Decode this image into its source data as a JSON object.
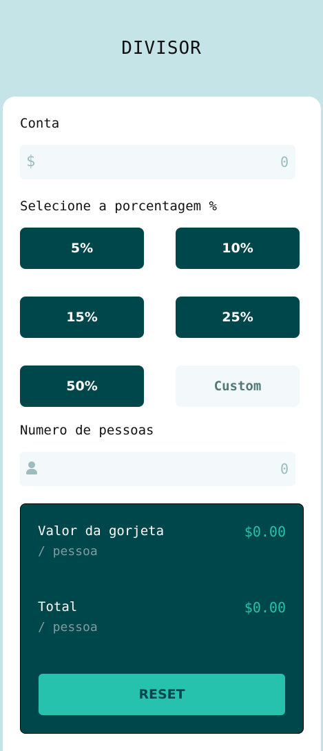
{
  "app": {
    "title": "DIVISOR"
  },
  "bill": {
    "label": "Conta",
    "prefix": "$",
    "value": "0",
    "icon": "dollar-icon"
  },
  "tip": {
    "label": "Selecione a porcentagem %",
    "options": [
      "5%",
      "10%",
      "15%",
      "25%",
      "50%"
    ],
    "custom_label": "Custom"
  },
  "people": {
    "label": "Numero de pessoas",
    "value": "0",
    "icon": "person-icon"
  },
  "results": {
    "tip_label": "Valor da gorjeta",
    "tip_sub": "/ pessoa",
    "tip_value": "$0.00",
    "total_label": "Total",
    "total_sub": "/ pessoa",
    "total_value": "$0.00",
    "reset_label": "RESET"
  },
  "colors": {
    "background": "#c5e4e7",
    "primary": "#00474b",
    "accent": "#26c2ae",
    "input_bg": "#f3f9fa"
  }
}
